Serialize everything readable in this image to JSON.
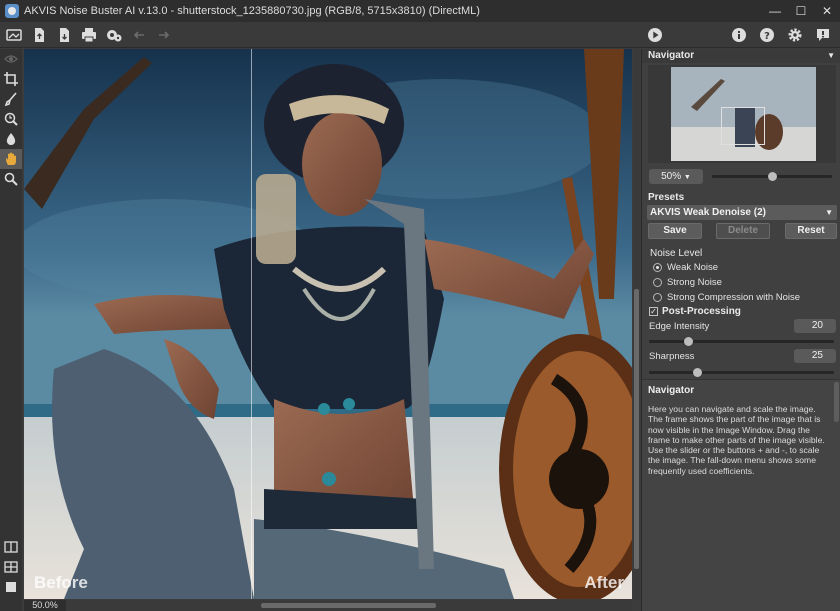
{
  "window": {
    "title": "AKVIS Noise Buster AI v.13.0 - shutterstock_1235880730.jpg (RGB/8, 5715x3810) (DirectML)",
    "controls": [
      "minimize-icon",
      "maximize-icon",
      "close-icon"
    ]
  },
  "toolbar": {
    "left_icons": [
      "before-after-icon",
      "open-file-icon",
      "save-file-icon",
      "print-icon",
      "batch-icon",
      "undo-icon",
      "redo-icon"
    ],
    "run_icon": "play-icon",
    "right_icons": [
      "info-icon",
      "help-icon",
      "settings-icon",
      "feedback-icon"
    ]
  },
  "tools": [
    "hand-icon-disabled",
    "crop-icon",
    "brush-icon",
    "history-brush-icon",
    "drop-icon",
    "hand-icon",
    "zoom-icon"
  ],
  "canvas": {
    "before_label": "Before",
    "after_label": "After"
  },
  "status": {
    "zoom": "50.0%"
  },
  "navigator": {
    "title": "Navigator",
    "zoom_value": "50%",
    "zoom_level": 0.5
  },
  "presets": {
    "label": "Presets",
    "selected": "AKVIS Weak Denoise (2)",
    "save_label": "Save",
    "delete_label": "Delete",
    "reset_label": "Reset"
  },
  "noise_level": {
    "title": "Noise Level",
    "options": [
      "Weak Noise",
      "Strong Noise",
      "Strong Compression with Noise"
    ],
    "selected_index": 0
  },
  "post_processing": {
    "label": "Post-Processing",
    "checked": true,
    "edge_intensity_label": "Edge Intensity",
    "edge_intensity_value": "20",
    "sharpness_label": "Sharpness",
    "sharpness_value": "25"
  },
  "help": {
    "title": "Navigator",
    "text": "Here you can navigate and scale the image. The frame shows the part of the image that is now visible in the Image Window. Drag the frame to make other parts of the image visible. Use the slider or the buttons + and -, to scale the image. The fall-down menu shows some frequently used coefficients."
  },
  "colors": {
    "panel_bg": "#404040",
    "window_bg": "#3c3c3c",
    "sky": "#2a4b66"
  }
}
